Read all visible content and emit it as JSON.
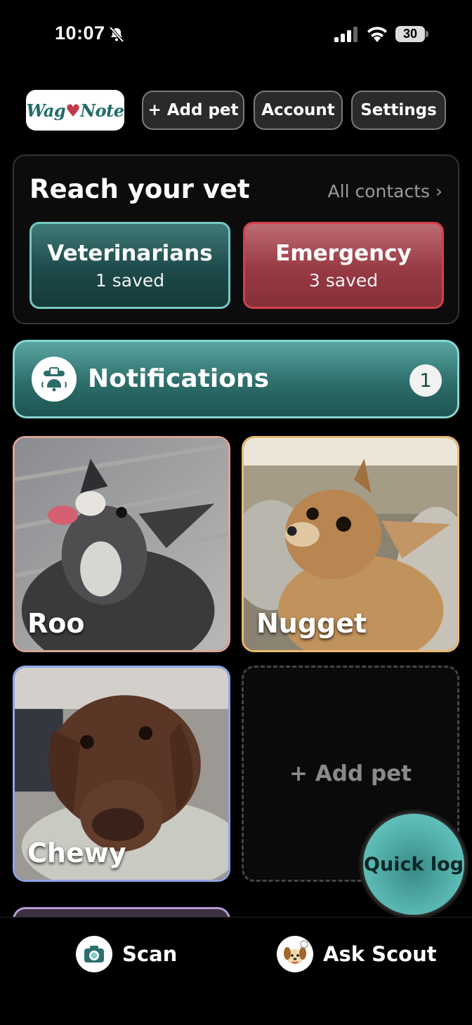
{
  "status_bar": {
    "time": "10:07",
    "battery": "30"
  },
  "nav": {
    "logo_text_a": "Wag",
    "logo_text_b": "Note",
    "add_pet": "+ Add pet",
    "account": "Account",
    "settings": "Settings"
  },
  "vet": {
    "title": "Reach your vet",
    "all_contacts": "All contacts ›",
    "veterinarians": {
      "label": "Veterinarians",
      "sub": "1 saved"
    },
    "emergency": {
      "label": "Emergency",
      "sub": "3 saved"
    }
  },
  "notifications": {
    "label": "Notifications",
    "count": "1"
  },
  "pets": [
    {
      "name": "Roo"
    },
    {
      "name": "Nugget"
    },
    {
      "name": "Chewy"
    }
  ],
  "add_pet_tile": "+ Add pet",
  "quick_log": "Quick log",
  "bottom": {
    "scan": "Scan",
    "ask_scout": "Ask Scout"
  },
  "colors": {
    "teal_accent": "#74c9c2",
    "emergency_red": "#d53d4a",
    "roo_border": "#d9a59a",
    "nugget_border": "#e9b974",
    "chewy_border": "#8ea7e4"
  },
  "icons": [
    "bell-off-icon",
    "signal-icon",
    "wifi-icon",
    "battery-icon",
    "notification-bell-icon",
    "camera-icon",
    "scout-dog-icon"
  ]
}
